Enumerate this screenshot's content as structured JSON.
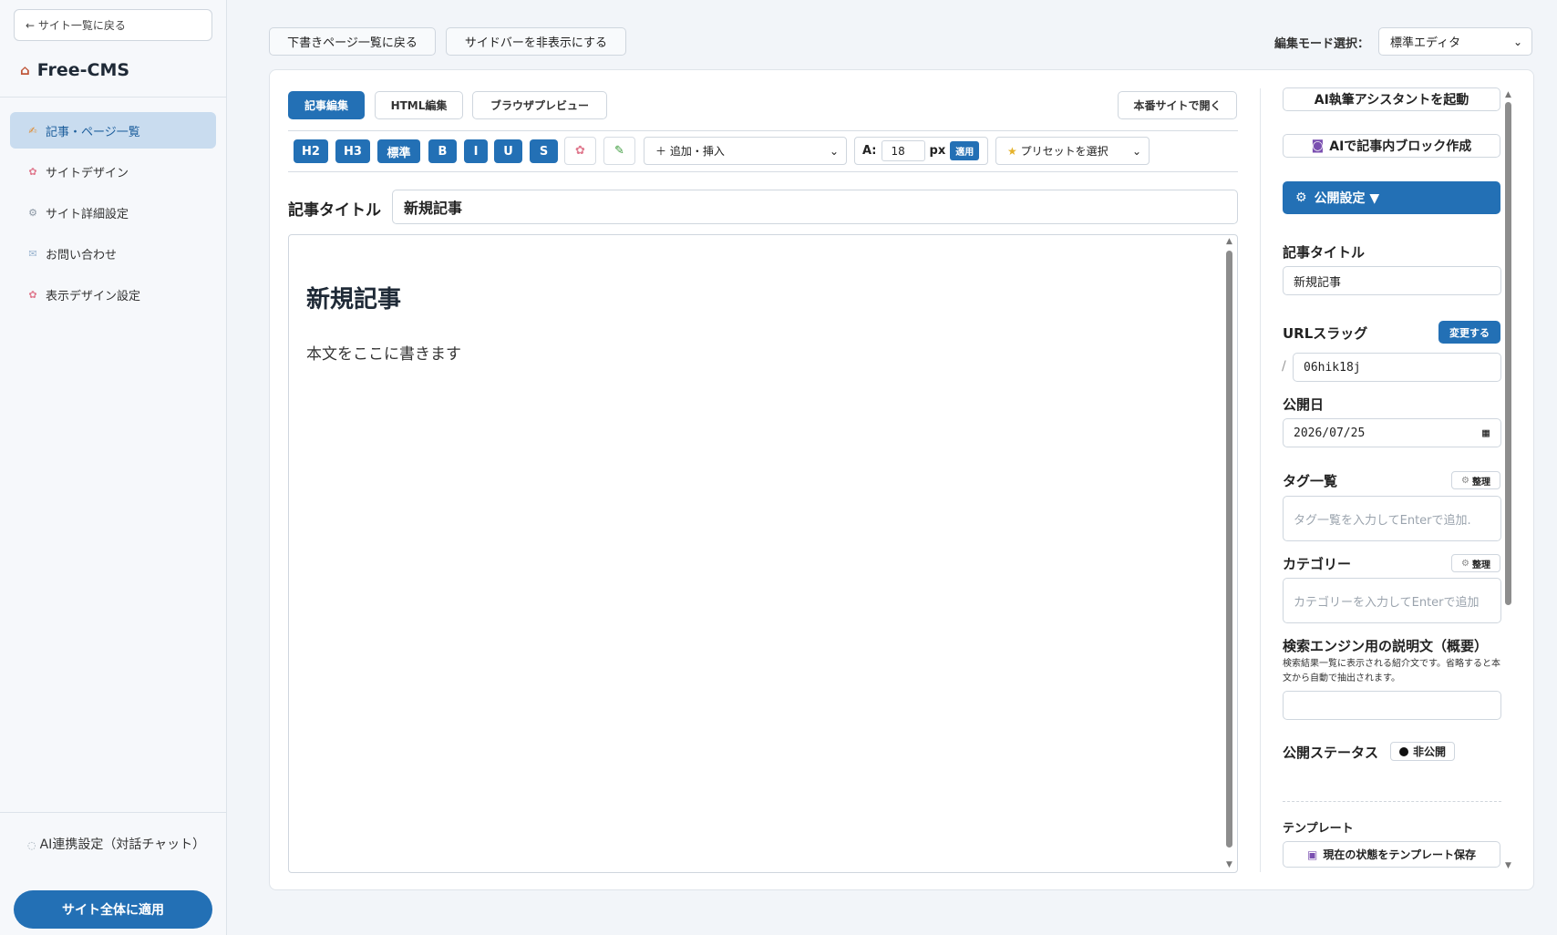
{
  "sidebar": {
    "back_label": "← サイト一覧に戻る",
    "brand": "Free-CMS",
    "items": [
      {
        "label": "記事・ページ一覧",
        "icon": "pencil-hand-icon"
      },
      {
        "label": "サイトデザイン",
        "icon": "palette-icon"
      },
      {
        "label": "サイト詳細設定",
        "icon": "gear-icon"
      },
      {
        "label": "お問い合わせ",
        "icon": "envelope-icon"
      },
      {
        "label": "表示デザイン設定",
        "icon": "palette-icon"
      }
    ],
    "ai_settings": "AI連携設定（対話チャット）",
    "apply_all": "サイト全体に適用"
  },
  "topbar": {
    "back_drafts": "下書きページ一覧に戻る",
    "hide_sidebar": "サイドバーを非表示にする",
    "mode_label": "編集モード選択：",
    "mode_value": "標準エディタ"
  },
  "tabs": {
    "edit": "記事編集",
    "html": "HTML編集",
    "preview": "ブラウザプレビュー",
    "open_live": "本番サイトで開く"
  },
  "toolbar": {
    "h2": "H2",
    "h3": "H3",
    "normal": "標準",
    "bold": "B",
    "italic": "I",
    "underline": "U",
    "strike": "S",
    "insert": "＋ 追加・挿入",
    "font_prefix": "A:",
    "font_size": "18",
    "font_unit": "px",
    "font_apply": "適用",
    "preset": "プリセットを選択"
  },
  "editor": {
    "title_label": "記事タイトル",
    "title_value": "新規記事",
    "heading": "新規記事",
    "body": "本文をここに書きます"
  },
  "settings": {
    "ai_assistant": "AI執筆アシスタントを起動",
    "ai_block": "AIで記事内ブロック作成",
    "publish_settings": "公開設定 ▼",
    "title_label": "記事タイトル",
    "title_value": "新規記事",
    "slug_label": "URLスラッグ",
    "slug_change": "変更する",
    "slug_prefix": "/",
    "slug_value": "06hik18j",
    "date_label": "公開日",
    "date_value": "2026/07/25",
    "tags_label": "タグ一覧",
    "tags_placeholder": "タグ一覧を入力してEnterで追加.",
    "organize": "整理",
    "category_label": "カテゴリー",
    "category_placeholder": "カテゴリーを入力してEnterで追加",
    "seo_label": "検索エンジン用の説明文（概要）",
    "seo_desc": "検索結果一覧に表示される紹介文です。省略すると本文から自動で抽出されます。",
    "status_label": "公開ステータス",
    "status_value": "非公開",
    "template_label": "テンプレート",
    "template_save": "現在の状態をテンプレート保存"
  },
  "colors": {
    "accent": "#2370b5",
    "active_nav_bg": "#c9dcef"
  }
}
